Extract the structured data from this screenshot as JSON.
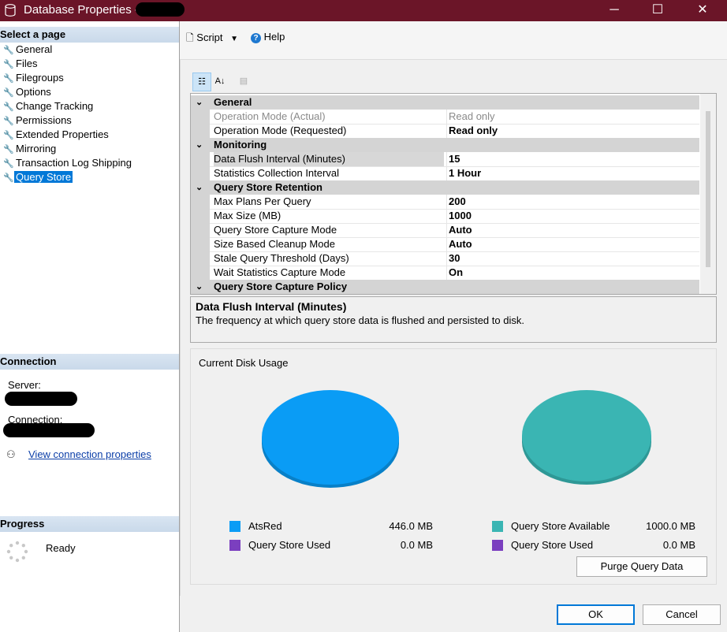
{
  "window": {
    "title": "Database Properties -",
    "minimize_glyph": "─",
    "maximize_glyph": "☐",
    "close_glyph": "✕"
  },
  "left": {
    "select_page_header": "Select a page",
    "pages": [
      {
        "label": "General"
      },
      {
        "label": "Files"
      },
      {
        "label": "Filegroups"
      },
      {
        "label": "Options"
      },
      {
        "label": "Change Tracking"
      },
      {
        "label": "Permissions"
      },
      {
        "label": "Extended Properties"
      },
      {
        "label": "Mirroring"
      },
      {
        "label": "Transaction Log Shipping"
      },
      {
        "label": "Query Store",
        "selected": true
      }
    ],
    "connection_header": "Connection",
    "server_label": "Server:",
    "connection_label": "Connection:",
    "view_connection_link": "View connection properties",
    "progress_header": "Progress",
    "progress_status": "Ready"
  },
  "toolbar": {
    "script_label": "Script",
    "help_label": "Help"
  },
  "property_grid": {
    "categories": [
      {
        "name": "General",
        "rows": [
          {
            "name": "Operation Mode (Actual)",
            "value": "Read only",
            "readonly": true
          },
          {
            "name": "Operation Mode (Requested)",
            "value": "Read only"
          }
        ]
      },
      {
        "name": "Monitoring",
        "rows": [
          {
            "name": "Data Flush Interval (Minutes)",
            "value": "15",
            "selected": true
          },
          {
            "name": "Statistics Collection Interval",
            "value": "1 Hour"
          }
        ]
      },
      {
        "name": "Query Store Retention",
        "rows": [
          {
            "name": "Max Plans Per Query",
            "value": "200"
          },
          {
            "name": "Max Size (MB)",
            "value": "1000"
          },
          {
            "name": "Query Store Capture Mode",
            "value": "Auto"
          },
          {
            "name": "Size Based Cleanup Mode",
            "value": "Auto"
          },
          {
            "name": "Stale Query Threshold (Days)",
            "value": "30"
          },
          {
            "name": "Wait Statistics Capture Mode",
            "value": "On"
          }
        ]
      },
      {
        "name": "Query Store Capture Policy",
        "rows": []
      }
    ]
  },
  "description": {
    "title": "Data Flush Interval (Minutes)",
    "text": "The frequency at which query store data is flushed and persisted to disk."
  },
  "disk_usage": {
    "header": "Current Disk Usage",
    "colors": {
      "database": "#0a9cf5",
      "used": "#7b3fbf",
      "available": "#3ab5b3"
    },
    "left_legend": [
      {
        "name": "AtsRed",
        "value": "446.0 MB",
        "color": "#0a9cf5"
      },
      {
        "name": "Query Store Used",
        "value": "0.0 MB",
        "color": "#7b3fbf"
      }
    ],
    "right_legend": [
      {
        "name": "Query Store Available",
        "value": "1000.0 MB",
        "color": "#3ab5b3"
      },
      {
        "name": "Query Store Used",
        "value": "0.0 MB",
        "color": "#7b3fbf"
      }
    ],
    "purge_button": "Purge Query Data"
  },
  "footer": {
    "ok_label": "OK",
    "cancel_label": "Cancel"
  }
}
